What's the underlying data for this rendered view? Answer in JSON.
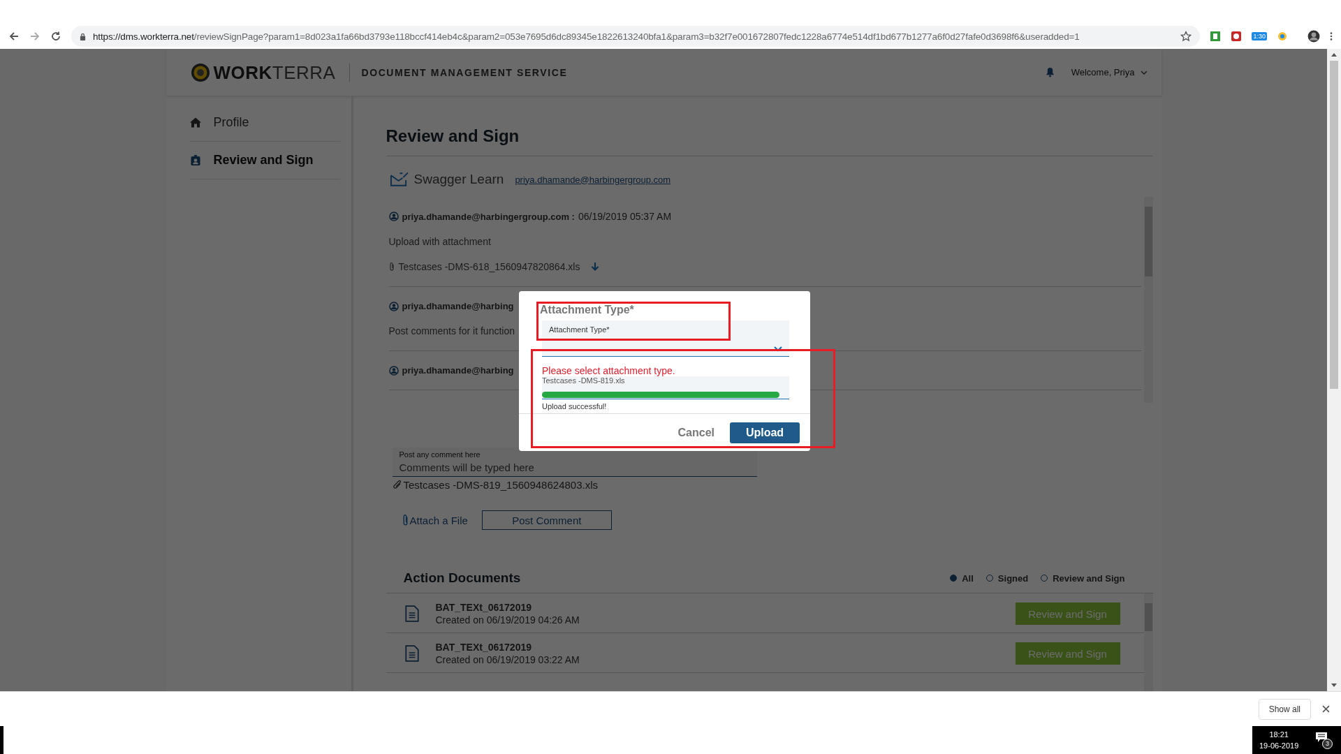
{
  "browser": {
    "url_host": "https://dms.workterra.net",
    "url_path": "/reviewSignPage?param1=8d023a1fa66bd3793e118bccf414eb4c&param2=053e7695d6dc89345e1822613240bfa1&param3=b32f7e001672807fedc1228a6774e514df1bd677b1277a6f0d27fafe0d3698f6&useradded=1",
    "extension_badge": "1:30"
  },
  "header": {
    "logo_bold": "WORK",
    "logo_light": "TERRA",
    "service": "DOCUMENT MANAGEMENT SERVICE",
    "welcome": "Welcome, Priya"
  },
  "sidebar": {
    "items": [
      {
        "label": "Profile",
        "selected": false
      },
      {
        "label": "Review and Sign",
        "selected": true
      }
    ]
  },
  "main": {
    "title": "Review and Sign",
    "document": {
      "name": "Swagger Learn",
      "email": "priya.dhamande@harbingergroup.com"
    },
    "comments": [
      {
        "author": "priya.dhamande@harbingergroup.com :",
        "timestamp": "06/19/2019 05:37 AM",
        "text": "Upload with attachment",
        "attachment": "Testcases -DMS-618_1560947820864.xls"
      },
      {
        "author": "priya.dhamande@harbing",
        "text": "Post comments for it function"
      },
      {
        "author": "priya.dhamande@harbing"
      }
    ],
    "comment_form": {
      "label": "Post any comment here",
      "placeholder": "Comments will be typed here",
      "attachment": "Testcases -DMS-819_1560948624803.xls",
      "attach_link": "Attach a File",
      "post_button": "Post Comment"
    },
    "action_documents": {
      "title": "Action Documents",
      "filters": [
        {
          "label": "All",
          "selected": true
        },
        {
          "label": "Signed",
          "selected": false
        },
        {
          "label": "Review and Sign",
          "selected": false
        }
      ],
      "documents": [
        {
          "name": "BAT_TEXt_06172019",
          "created": "Created on 06/19/2019 04:26 AM",
          "button": "Review and Sign"
        },
        {
          "name": "BAT_TEXt_06172019",
          "created": "Created on 06/19/2019 03:22 AM",
          "button": "Review and Sign"
        }
      ]
    }
  },
  "modal": {
    "label": "Attachment Type*",
    "select_placeholder": "Attachment Type*",
    "error": "Please select attachment type.",
    "file_name": "Testcases -DMS-819.xls",
    "level": 0.96,
    "status": "Upload successful!",
    "cancel": "Cancel",
    "upload": "Upload"
  },
  "download_bar": {
    "show_all": "Show all"
  },
  "taskbar": {
    "time": "18:21",
    "date": "19-06-2019",
    "notifications": "3"
  }
}
